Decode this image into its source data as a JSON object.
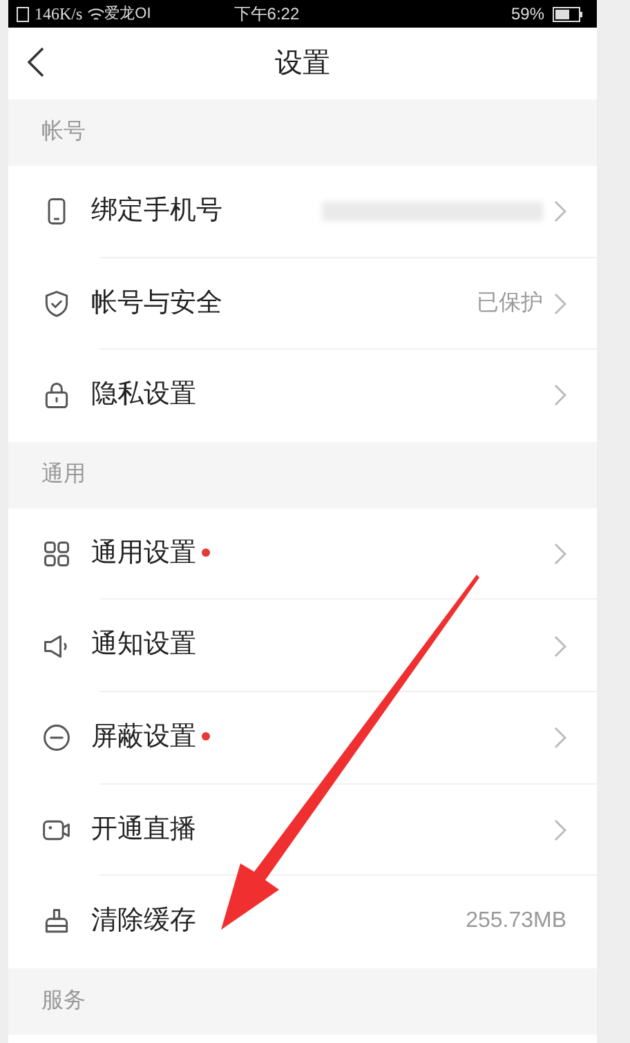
{
  "status_bar": {
    "speed": "146K/s",
    "carrier": "爱龙OI",
    "time": "下午6:22",
    "battery": "59%"
  },
  "header": {
    "title": "设置"
  },
  "sections": [
    {
      "title": "帐号",
      "items": [
        {
          "kind": "phone",
          "label": "绑定手机号",
          "redacted": true,
          "dot": false,
          "chevron": true
        },
        {
          "kind": "shield",
          "label": "帐号与安全",
          "value": "已保护",
          "redacted": false,
          "dot": false,
          "chevron": true
        },
        {
          "kind": "lock",
          "label": "隐私设置",
          "redacted": false,
          "dot": false,
          "chevron": true
        }
      ]
    },
    {
      "title": "通用",
      "items": [
        {
          "kind": "grid",
          "label": "通用设置",
          "redacted": false,
          "dot": true,
          "chevron": true
        },
        {
          "kind": "speaker",
          "label": "通知设置",
          "redacted": false,
          "dot": false,
          "chevron": true
        },
        {
          "kind": "minus",
          "label": "屏蔽设置",
          "redacted": false,
          "dot": true,
          "chevron": true
        },
        {
          "kind": "camera",
          "label": "开通直播",
          "redacted": false,
          "dot": false,
          "chevron": true
        },
        {
          "kind": "brush",
          "label": "清除缓存",
          "value": "255.73MB",
          "redacted": false,
          "dot": false,
          "chevron": false
        }
      ]
    },
    {
      "title": "服务"
    }
  ]
}
